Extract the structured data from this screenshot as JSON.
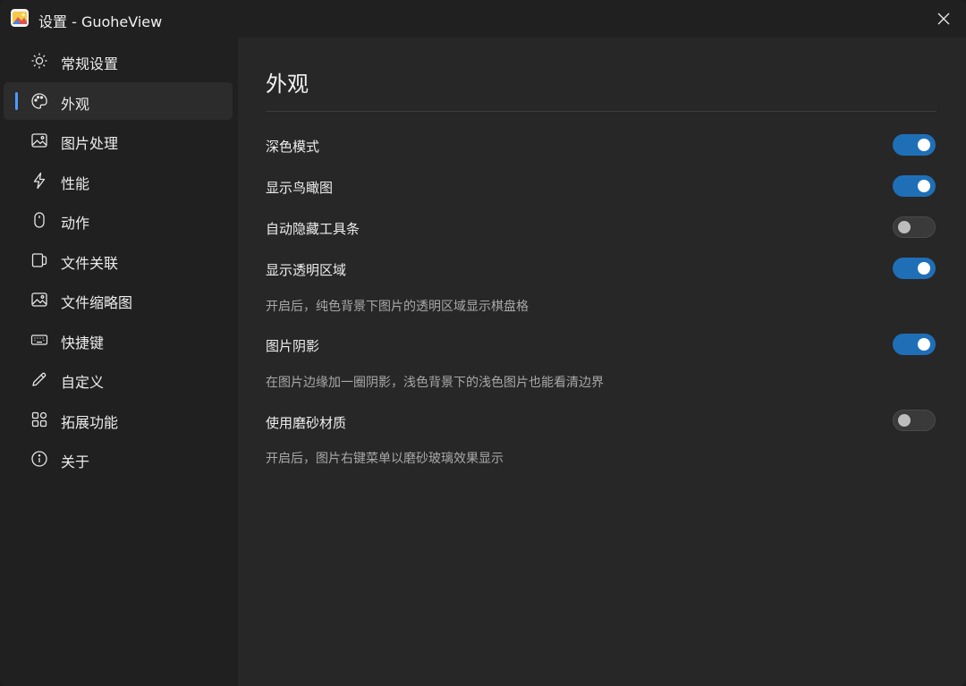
{
  "window": {
    "title": "设置 - GuoheView"
  },
  "sidebar": {
    "items": [
      {
        "label": "常规设置",
        "icon": "sun-icon",
        "active": false
      },
      {
        "label": "外观",
        "icon": "palette-icon",
        "active": true
      },
      {
        "label": "图片处理",
        "icon": "image-icon",
        "active": false
      },
      {
        "label": "性能",
        "icon": "lightning-icon",
        "active": false
      },
      {
        "label": "动作",
        "icon": "mouse-icon",
        "active": false
      },
      {
        "label": "文件关联",
        "icon": "file-link-icon",
        "active": false
      },
      {
        "label": "文件缩略图",
        "icon": "thumbnail-icon",
        "active": false
      },
      {
        "label": "快捷键",
        "icon": "keyboard-icon",
        "active": false
      },
      {
        "label": "自定义",
        "icon": "pencil-icon",
        "active": false
      },
      {
        "label": "拓展功能",
        "icon": "apps-icon",
        "active": false
      },
      {
        "label": "关于",
        "icon": "info-icon",
        "active": false
      }
    ]
  },
  "content": {
    "title": "外观",
    "settings": [
      {
        "label": "深色模式",
        "enabled": true
      },
      {
        "label": "显示鸟瞰图",
        "enabled": true
      },
      {
        "label": "自动隐藏工具条",
        "enabled": false
      },
      {
        "label": "显示透明区域",
        "enabled": true,
        "description": "开启后，纯色背景下图片的透明区域显示棋盘格"
      },
      {
        "label": "图片阴影",
        "enabled": true,
        "description": "在图片边缘加一圈阴影，浅色背景下的浅色图片也能看清边界"
      },
      {
        "label": "使用磨砂材质",
        "enabled": false,
        "description": "开启后，图片右键菜单以磨砂玻璃效果显示"
      }
    ]
  },
  "colors": {
    "accent": "#1f6fb7",
    "indicator": "#4c9aff",
    "background": "#202020",
    "content_background": "#272727"
  }
}
